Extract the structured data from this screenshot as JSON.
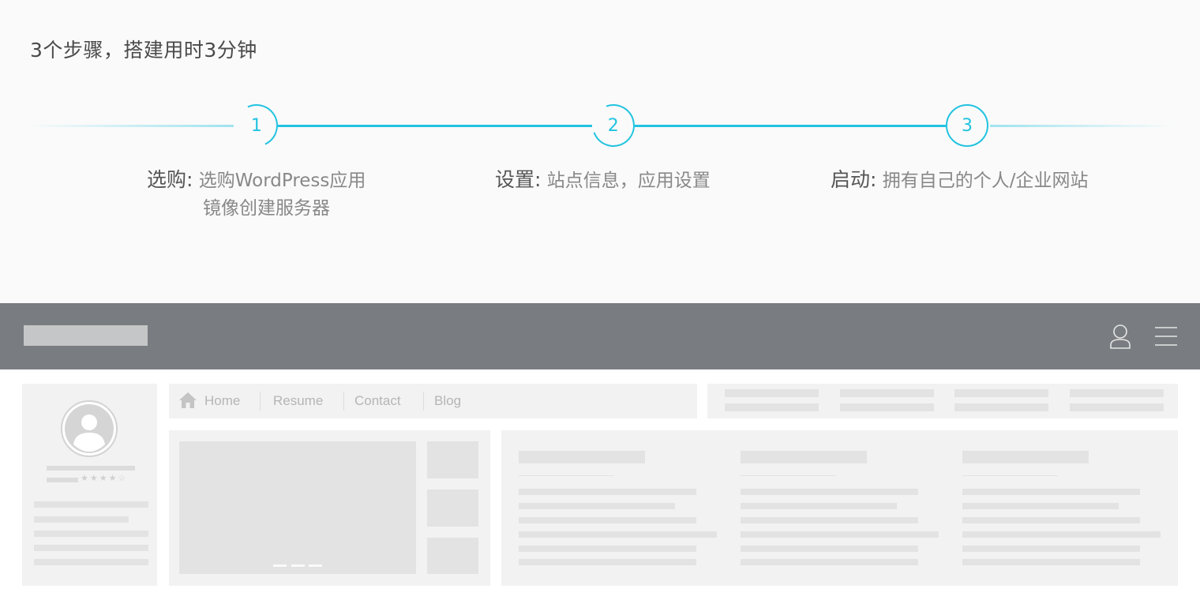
{
  "hero": {
    "title": "3个步骤，搭建用时3分钟",
    "accent_color": "#22c3e0",
    "steps": [
      {
        "number": "1",
        "head": "选购:",
        "desc_line1": "选购WordPress应用",
        "desc_line2": "镜像创建服务器"
      },
      {
        "number": "2",
        "head": "设置:",
        "desc_line1": "站点信息，应用设置",
        "desc_line2": ""
      },
      {
        "number": "3",
        "head": "启动:",
        "desc_line1": "拥有自己的个人/企业网站",
        "desc_line2": ""
      }
    ]
  },
  "mockup": {
    "topbar": {
      "user_icon": "user-icon",
      "menu_icon": "hamburger-menu-icon"
    },
    "nav": {
      "home_icon": "home-icon",
      "items": [
        "Home",
        "Resume",
        "Contact",
        "Blog"
      ]
    },
    "profile": {
      "avatar_icon": "avatar-icon",
      "rating_stars": "★★★★☆"
    }
  }
}
